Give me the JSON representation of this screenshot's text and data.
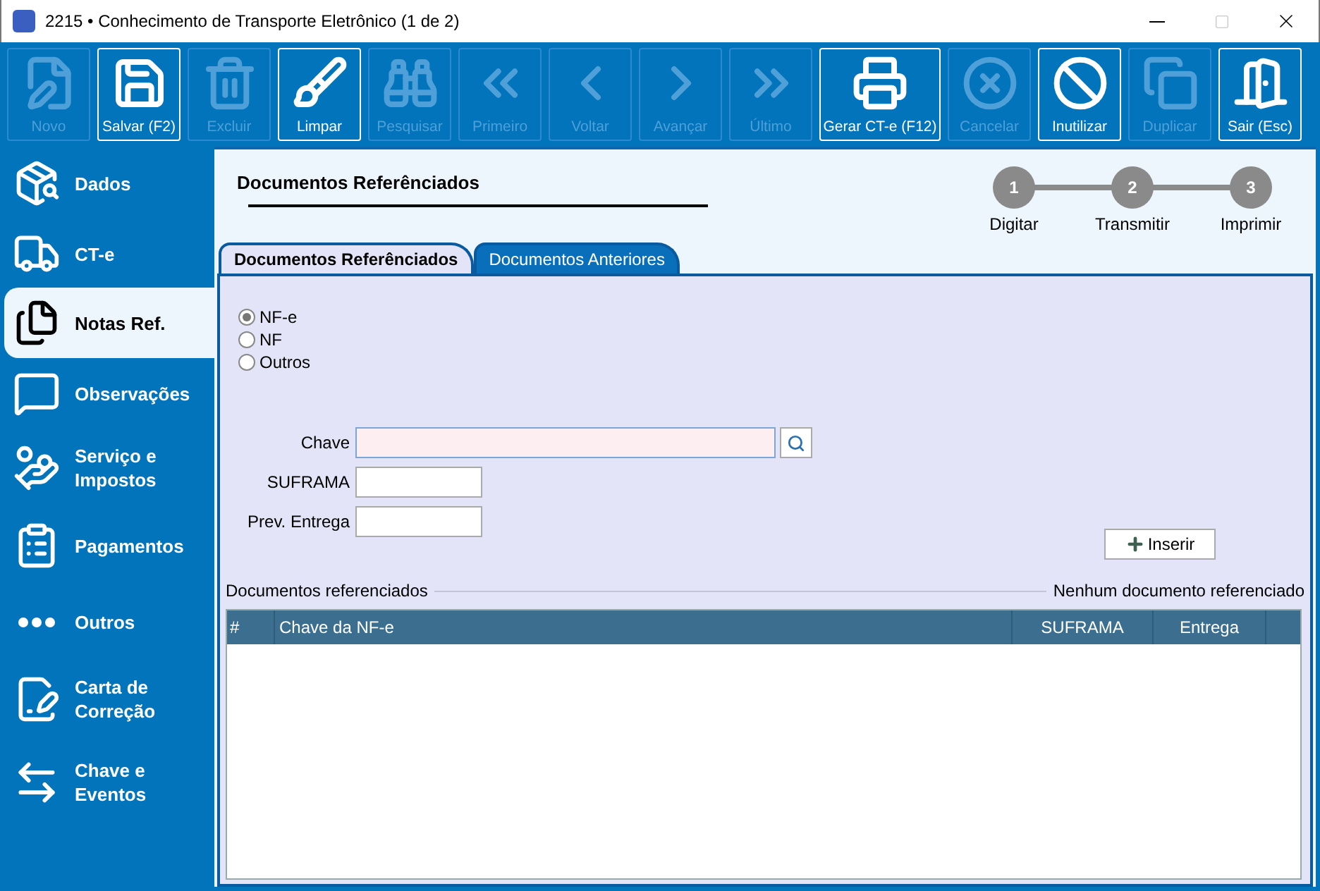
{
  "window": {
    "title": "2215 • Conhecimento de Transporte Eletrônico (1 de 2)"
  },
  "toolbar": [
    {
      "label": "Novo",
      "disabled": true
    },
    {
      "label": "Salvar (F2)",
      "disabled": false
    },
    {
      "label": "Excluir",
      "disabled": true
    },
    {
      "label": "Limpar",
      "disabled": false
    },
    {
      "label": "Pesquisar",
      "disabled": true
    },
    {
      "label": "Primeiro",
      "disabled": true
    },
    {
      "label": "Voltar",
      "disabled": true
    },
    {
      "label": "Avançar",
      "disabled": true
    },
    {
      "label": "Último",
      "disabled": true
    },
    {
      "label": "Gerar CT-e (F12)",
      "disabled": false
    },
    {
      "label": "Cancelar",
      "disabled": true
    },
    {
      "label": "Inutilizar",
      "disabled": false
    },
    {
      "label": "Duplicar",
      "disabled": true
    },
    {
      "label": "Sair (Esc)",
      "disabled": false
    }
  ],
  "sidebar": {
    "items": [
      {
        "label": "Dados",
        "selected": false
      },
      {
        "label": "CT-e",
        "selected": false
      },
      {
        "label": "Notas Ref.",
        "selected": true
      },
      {
        "label": "Observações",
        "selected": false
      },
      {
        "label": "Serviço e Impostos",
        "selected": false
      },
      {
        "label": "Pagamentos",
        "selected": false
      },
      {
        "label": "Outros",
        "selected": false
      },
      {
        "label": "Carta de Correção",
        "selected": false
      },
      {
        "label": "Chave e Eventos",
        "selected": false
      }
    ]
  },
  "page_title": "Documentos Referênciados",
  "steps": [
    {
      "number": "1",
      "label": "Digitar"
    },
    {
      "number": "2",
      "label": "Transmitir"
    },
    {
      "number": "3",
      "label": "Imprimir"
    }
  ],
  "tabs": [
    {
      "label": "Documentos Referênciados",
      "selected": true
    },
    {
      "label": "Documentos Anteriores",
      "selected": false
    }
  ],
  "document_type": [
    {
      "label": "NF-e",
      "selected": true
    },
    {
      "label": "NF",
      "selected": false
    },
    {
      "label": "Outros",
      "selected": false
    }
  ],
  "fields": [
    {
      "label": "Chave",
      "kind": "search"
    },
    {
      "label": "SUFRAMA",
      "kind": "short"
    },
    {
      "label": "Prev. Entrega",
      "kind": "short"
    }
  ],
  "insert_button": "Inserir",
  "list_title": "Documentos referenciados",
  "list_status": "Nenhum documento referenciado",
  "table": {
    "columns": [
      "#",
      "Chave da NF-e",
      "SUFRAMA",
      "Entrega"
    ]
  }
}
